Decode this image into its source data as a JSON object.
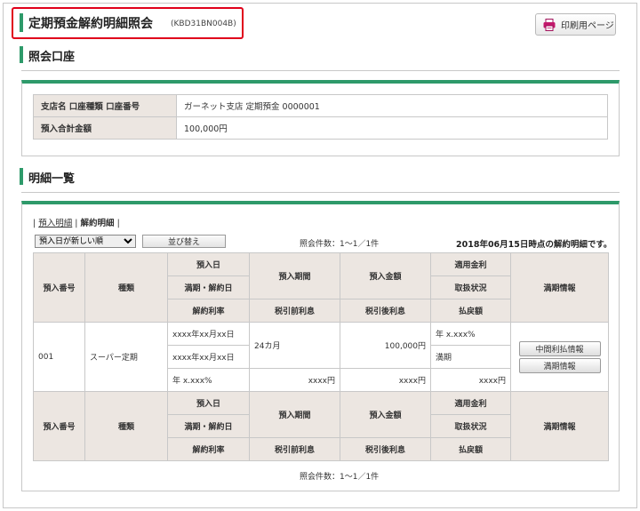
{
  "header": {
    "title": "定期預金解約明細照会",
    "code": "(KBD31BN004B)",
    "print_label": "印刷用ページ"
  },
  "account_section": {
    "title": "照会口座",
    "rows": [
      {
        "label": "支店名 口座種類 口座番号",
        "value": "ガーネット支店 定期預金 0000001"
      },
      {
        "label": "預入合計金額",
        "value": "100,000円"
      }
    ]
  },
  "detail_section": {
    "title": "明細一覧",
    "links": {
      "deposit": "預入明細",
      "separator": "|",
      "cancel": "解約明細"
    },
    "sort": {
      "selected": "預入日が新しい順",
      "button": "並び替え"
    },
    "count": "照会件数：1〜1／1件",
    "as_of": "2018年06月15日時点の解約明細です。",
    "headers": {
      "no": "預入番号",
      "kind": "種類",
      "date": "預入日",
      "maturity": "満期・解約日",
      "rate": "解約利率",
      "period": "預入期間",
      "pretax": "税引前利息",
      "amount": "預入金額",
      "aftertax": "税引後利息",
      "applied_rate": "適用金利",
      "handling": "取扱状況",
      "payout": "払戻額",
      "maturity_info": "満期情報"
    },
    "row": {
      "no": "001",
      "kind": "スーパー定期",
      "date": "xxxx年xx月xx日",
      "maturity": "xxxx年xx月xx日",
      "rate": "年 x.xxx%",
      "period": "24カ月",
      "pretax": "xxxx円",
      "amount": "100,000円",
      "aftertax": "xxxx円",
      "applied_rate": "年 x.xxx%",
      "handling": "満期",
      "payout": "xxxx円",
      "btn_interim": "中間利払情報",
      "btn_maturity": "満期情報"
    }
  }
}
